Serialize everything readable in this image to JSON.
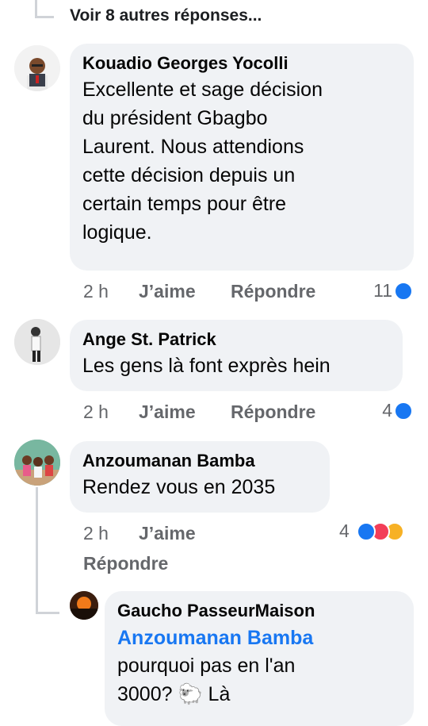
{
  "more_replies": "Voir 8 autres réponses...",
  "comments": [
    {
      "author": "Kouadio Georges Yocolli",
      "lines": [
        "Excellente et sage décision",
        "du président Gbagbo",
        "Laurent. Nous attendions",
        "cette décision depuis un",
        "certain temps pour être",
        "logique."
      ],
      "time": "2 h",
      "like": "J’aime",
      "reply": "Répondre",
      "reactions": "11"
    },
    {
      "author": "Ange St. Patrick",
      "lines": [
        "Les gens là font exprès hein"
      ],
      "time": "2 h",
      "like": "J’aime",
      "reply": "Répondre",
      "reactions": "4"
    },
    {
      "author": "Anzoumanan Bamba",
      "lines": [
        "Rendez vous en 2035"
      ],
      "time": "2 h",
      "like": "J’aime",
      "reply": "Répondre",
      "reactions": "4"
    }
  ],
  "nested_reply": {
    "author": "Gaucho PasseurMaison",
    "mention": "Anzoumanan Bamba",
    "lines": [
      "pourquoi pas en l'an",
      "3000? 🐑 Là"
    ]
  },
  "colors": {
    "link": "#1877f2",
    "bubble": "#f0f2f5",
    "meta": "#65676b"
  }
}
